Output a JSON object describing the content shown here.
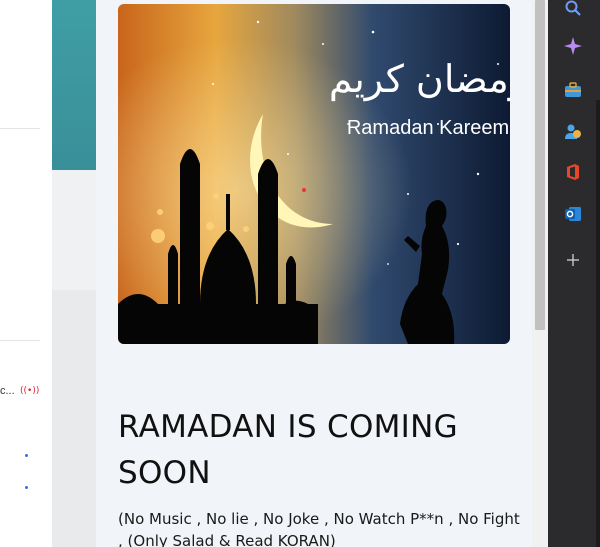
{
  "left_panel": {
    "truncated_text": "c..."
  },
  "post": {
    "title": "RAMADAN IS COMING SOON",
    "body": "(No Music , No lie , No Joke , No Watch P**n , No Fight , (Only Salad & Read KORAN)"
  },
  "banner": {
    "arabic_text": "رمضان كريم",
    "caption": "Ramadan Kareem"
  },
  "sidebar_rail": {
    "items": [
      {
        "icon": "search-icon"
      },
      {
        "icon": "copilot-sparkle-icon"
      },
      {
        "icon": "toolbox-icon"
      },
      {
        "icon": "people-icon"
      },
      {
        "icon": "office-icon"
      },
      {
        "icon": "outlook-icon"
      },
      {
        "icon": "add-icon"
      }
    ]
  },
  "colors": {
    "rail_bg": "#2b2b2d",
    "modal_bg": "#f1f4f8",
    "teal": "#3f9ea5"
  }
}
